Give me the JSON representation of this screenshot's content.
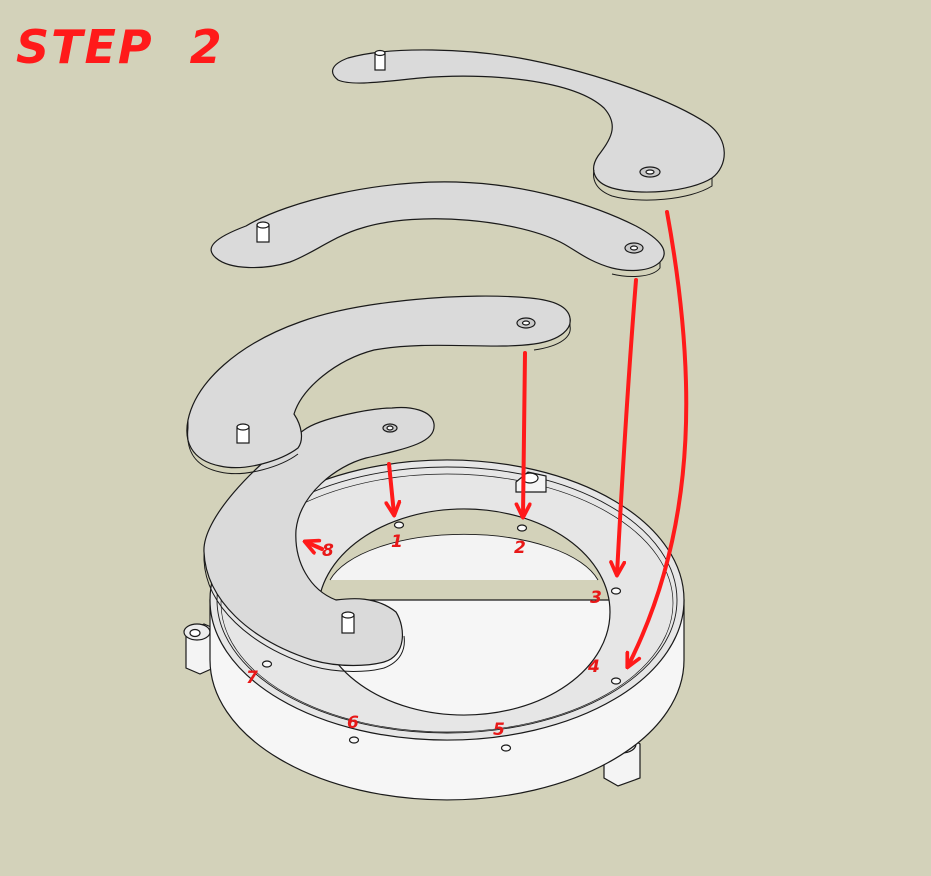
{
  "title": "STEP  2",
  "hole_labels": [
    "1",
    "2",
    "3",
    "4",
    "5",
    "6",
    "7",
    "8"
  ],
  "colors": {
    "background": "#d3d2ba",
    "part": "#dadada",
    "outline": "#1a1a1a",
    "arrow": "#ff1a1a",
    "label": "#e81818"
  }
}
